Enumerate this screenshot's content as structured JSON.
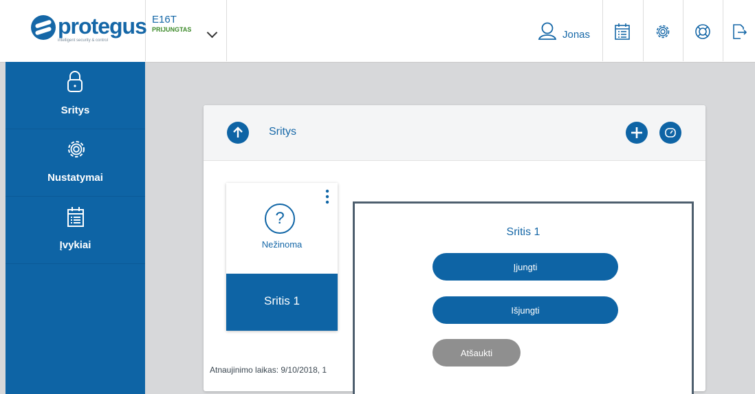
{
  "brand": {
    "name": "protegus",
    "tagline": "intelligent security & control"
  },
  "device": {
    "name": "E16T",
    "status": "PRIJUNGTAS"
  },
  "user": {
    "name": "Jonas"
  },
  "toolbar_icons": [
    "calendar-list-icon",
    "gear-icon",
    "lifebuoy-icon",
    "logout-icon"
  ],
  "sidebar": {
    "items": [
      {
        "label": "Sritys",
        "icon": "lock-icon"
      },
      {
        "label": "Nustatymai",
        "icon": "gear-icon"
      },
      {
        "label": "Įvykiai",
        "icon": "calendar-list-icon"
      }
    ]
  },
  "panel": {
    "title": "Sritys",
    "updated": "Atnaujinimo laikas: 9/10/2018, 1"
  },
  "area_card": {
    "state": "Nežinoma",
    "name": "Sritis 1",
    "state_icon": "question-icon"
  },
  "dialog": {
    "title": "Sritis 1",
    "arm_label": "Įjungti",
    "disarm_label": "Išjungti",
    "cancel_label": "Atšaukti"
  },
  "colors": {
    "primary": "#0e64a5",
    "online": "#3d8a2a",
    "cancel": "#8f8f8f",
    "background": "#d7d8da"
  }
}
